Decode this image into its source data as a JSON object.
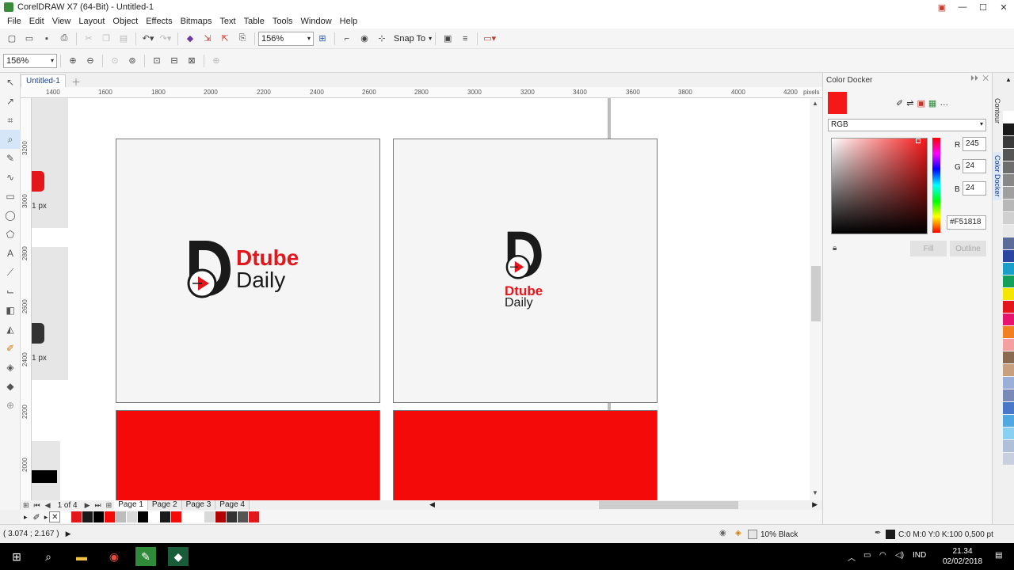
{
  "window": {
    "title": "CorelDRAW X7 (64-Bit) - Untitled-1"
  },
  "menu": [
    "File",
    "Edit",
    "View",
    "Layout",
    "Object",
    "Effects",
    "Bitmaps",
    "Text",
    "Table",
    "Tools",
    "Window",
    "Help"
  ],
  "toolbar": {
    "zoom_value": "156%",
    "snap_label": "Snap To"
  },
  "property_bar": {
    "zoom_value": "156%"
  },
  "document": {
    "tab_label": "Untitled-1"
  },
  "ruler": {
    "unit": "pixels",
    "h_ticks": [
      "1400",
      "1600",
      "1800",
      "2000",
      "2200",
      "2400",
      "2600",
      "2800",
      "3000",
      "3200",
      "3400",
      "3600",
      "3800",
      "4000",
      "4200"
    ],
    "v_ticks": [
      "3200",
      "3000",
      "2800",
      "2600",
      "2400",
      "2200",
      "2000"
    ]
  },
  "canvas": {
    "partial_labels": [
      "1 px",
      "1 px"
    ],
    "artboards": [
      {
        "brand": "Dtube",
        "sub": "Daily",
        "layout": "horizontal"
      },
      {
        "brand": "Dtube",
        "sub": "Daily",
        "layout": "stacked"
      }
    ]
  },
  "pages": {
    "counter": "1 of 4",
    "tabs": [
      "Page 1",
      "Page 2",
      "Page 3",
      "Page 4"
    ],
    "active": "Page 1"
  },
  "doc_palette": [
    "#ffffff",
    "#e3171b",
    "#1a1a1a",
    "#000000",
    "#f50a0a",
    "#bdbdbd",
    "#d9d9d9",
    "#000000",
    "#ffffff",
    "#1a1a1a",
    "#f50a0a",
    "#ffffff",
    "#ffffff",
    "#d9d9d9",
    "#b30000",
    "#333333",
    "#555555",
    "#e3171b"
  ],
  "status": {
    "coords": "( 3.074 ; 2.167 )",
    "fill_label": "10% Black",
    "outline_label": "C:0 M:0 Y:0 K:100  0,500 pt"
  },
  "color_docker": {
    "title": "Color Docker",
    "model": "RGB",
    "current_color": "#f51818",
    "r_label": "R",
    "g_label": "G",
    "b_label": "B",
    "r": "245",
    "g": "24",
    "b": "24",
    "hex": "#F51818",
    "fill_button": "Fill",
    "outline_button": "Outline"
  },
  "side_tabs": [
    "Contour",
    "Color Docker"
  ],
  "right_palette": [
    "#ffffff",
    "#1a1a1a",
    "#3a3a3a",
    "#555555",
    "#6e6e6e",
    "#888888",
    "#a0a0a0",
    "#b8b8b8",
    "#d0d0d0",
    "#e8e8e8",
    "#5b6b9a",
    "#2a46a0",
    "#1aa0c8",
    "#14a05a",
    "#f5e600",
    "#e3171b",
    "#e8136e",
    "#f08020",
    "#f4a0a0",
    "#8a6a50",
    "#c8a080",
    "#9ab0d8",
    "#7a8ab8",
    "#4a78c8",
    "#50a8e0",
    "#8ad0f0",
    "#b0c0d8",
    "#c8d0e0"
  ],
  "taskbar": {
    "lang": "IND",
    "time": "21.34",
    "date": "02/02/2018"
  }
}
